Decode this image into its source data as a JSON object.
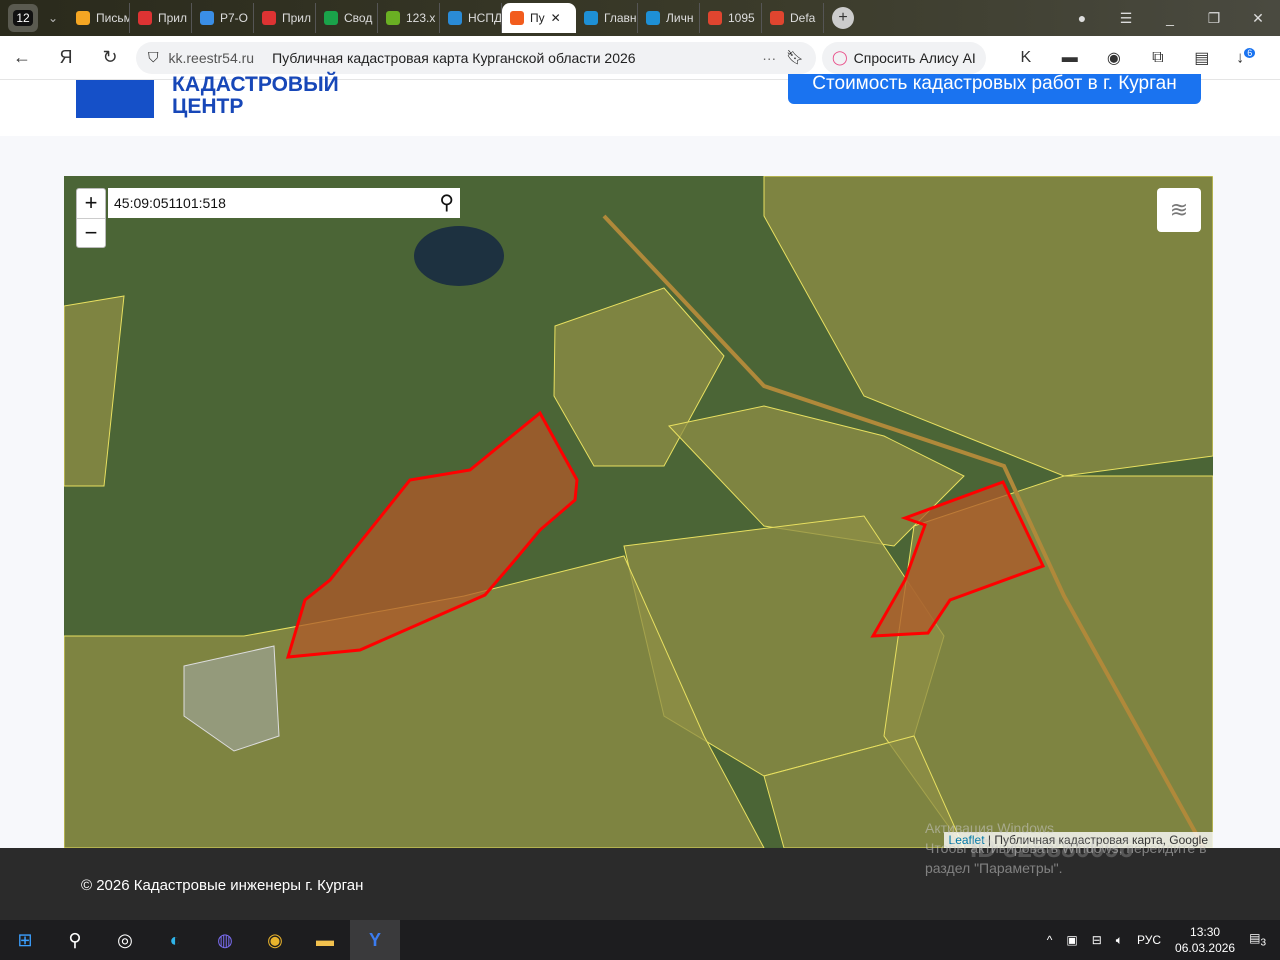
{
  "browser": {
    "tab_count": "12",
    "tabs": [
      {
        "label": "Письма",
        "color": "#f5a623"
      },
      {
        "label": "Прил",
        "color": "#d33"
      },
      {
        "label": "Р7-О",
        "color": "#3a8ee6"
      },
      {
        "label": "Прил",
        "color": "#d33"
      },
      {
        "label": "Свод",
        "color": "#1aa34a"
      },
      {
        "label": "123.x",
        "color": "#6ab023"
      },
      {
        "label": "НСПД",
        "color": "#2a8bd6"
      },
      {
        "label": "Пу",
        "color": "#f25c1d",
        "active": true
      },
      {
        "label": "Главн",
        "color": "#1e90d6"
      },
      {
        "label": "Личн",
        "color": "#1e90d6"
      },
      {
        "label": "1095",
        "color": "#e0452f"
      },
      {
        "label": "Defa",
        "color": "#e0452f"
      }
    ],
    "url_domain": "kk.reestr54.ru",
    "page_title": "Публичная кадастровая карта Курганской области 2026",
    "alice_button": "Спросить Алису AI",
    "downloads_badge": "6"
  },
  "site": {
    "logo_line1": "КАДАСТРОВЫЙ",
    "logo_line2": "ЦЕНТР",
    "cta": "Стоимость кадастровых работ в г. Курган",
    "footer": "© 2026 Кадастровые инженеры г. Курган"
  },
  "map": {
    "search_value": "45:09:051101:518",
    "zoom_in": "+",
    "zoom_out": "−",
    "attribution_link": "Leaflet",
    "attribution_text": "| Публичная кадастровая карта, Google",
    "highlight_color": "#ff0000",
    "parcel_color": "#e8e060"
  },
  "watermark": {
    "line1": "Активация Windows",
    "line2": "Чтобы активировать Windows, перейдите в",
    "line3": "раздел \"Параметры\".",
    "id": "ID 328880096"
  },
  "taskbar": {
    "lang": "РУС",
    "time": "13:30",
    "date": "06.03.2026",
    "notifications": "3"
  }
}
